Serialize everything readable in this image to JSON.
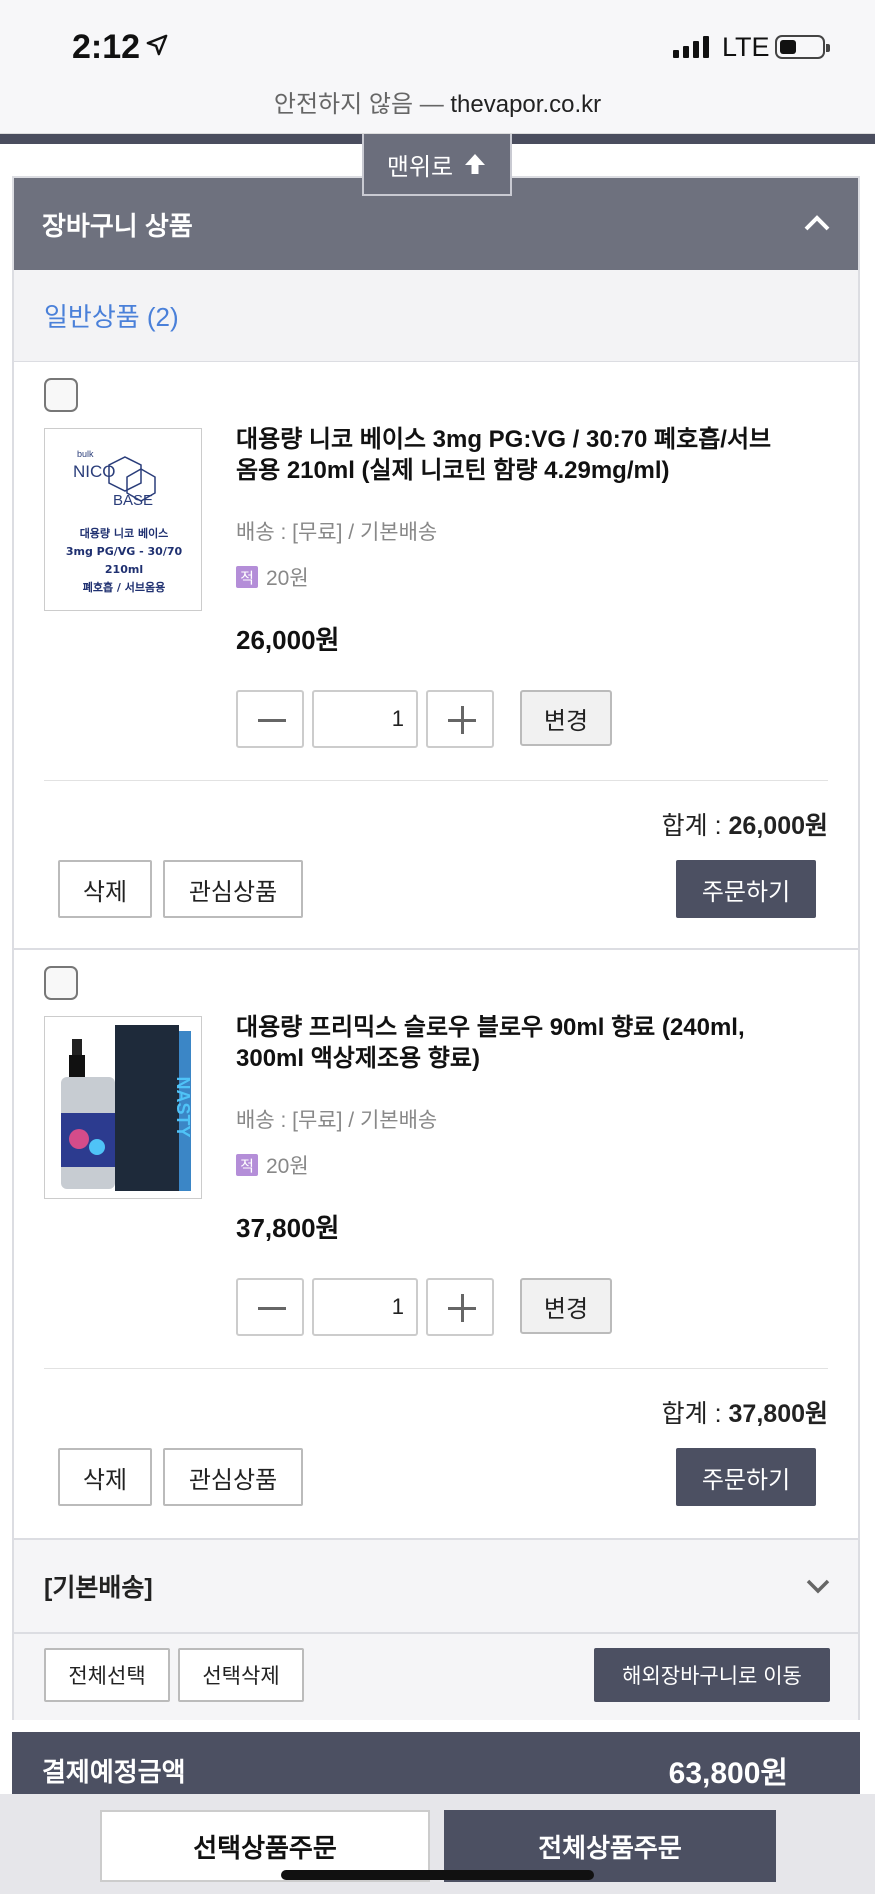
{
  "status_bar": {
    "time": "2:12",
    "network": "LTE"
  },
  "browser": {
    "security_label": "안전하지 않음 —",
    "domain": "thevapor.co.kr"
  },
  "scroll_top_button": "맨위로",
  "cart": {
    "header_title": "장바구니 상품",
    "group_label": "일반상품 (2)",
    "items": [
      {
        "name": "대용량 니코 베이스 3mg PG:VG / 30:70 폐호흡/서브옴용 210ml (실제 니코틴 함량 4.29mg/ml)",
        "name_line1": "대용량 니코 베이스 3mg PG:VG / 30:70 폐호흡/서브",
        "name_line2": "옴용 210ml (실제 니코틴 함량 4.29mg/ml)",
        "shipping": "배송 : [무료] / 기본배송",
        "points_badge": "적",
        "points": "20원",
        "price": "26,000원",
        "quantity": "1",
        "change_label": "변경",
        "total_label": "합계 :",
        "total_value": "26,000원",
        "delete_label": "삭제",
        "wishlist_label": "관심상품",
        "order_label": "주문하기",
        "thumb_text": {
          "brand_small": "bulk",
          "brand_nico": "NICO",
          "brand_base": "BASE",
          "line1": "대용량 니코 베이스",
          "line2": "3mg PG/VG - 30/70",
          "line3": "210ml",
          "line4": "폐호흡 / 서브옴용"
        }
      },
      {
        "name": "대용량 프리믹스 슬로우 블로우 90ml 향료 (240ml, 300ml 액상제조용 향료)",
        "name_line1": "대용량 프리믹스 슬로우 블로우 90ml 향료 (240ml,",
        "name_line2": "300ml 액상제조용 향료)",
        "shipping": "배송 : [무료] / 기본배송",
        "points_badge": "적",
        "points": "20원",
        "price": "37,800원",
        "quantity": "1",
        "change_label": "변경",
        "total_label": "합계 :",
        "total_value": "37,800원",
        "delete_label": "삭제",
        "wishlist_label": "관심상품",
        "order_label": "주문하기",
        "thumb_text": {
          "box_brand": "NASTY"
        }
      }
    ],
    "shipping_group": "[기본배송]",
    "select_all": "전체선택",
    "delete_selected": "선택삭제",
    "move_overseas": "해외장바구니로 이동"
  },
  "payment": {
    "label": "결제예정금액",
    "amount": "63,800원"
  },
  "bottom_bar": {
    "order_selected": "선택상품주문",
    "order_all": "전체상품주문"
  },
  "colors": {
    "header_bg": "#6e717e",
    "dark_button": "#4c5062",
    "group_text": "#4a80d9",
    "points_badge": "#b48ed8"
  }
}
